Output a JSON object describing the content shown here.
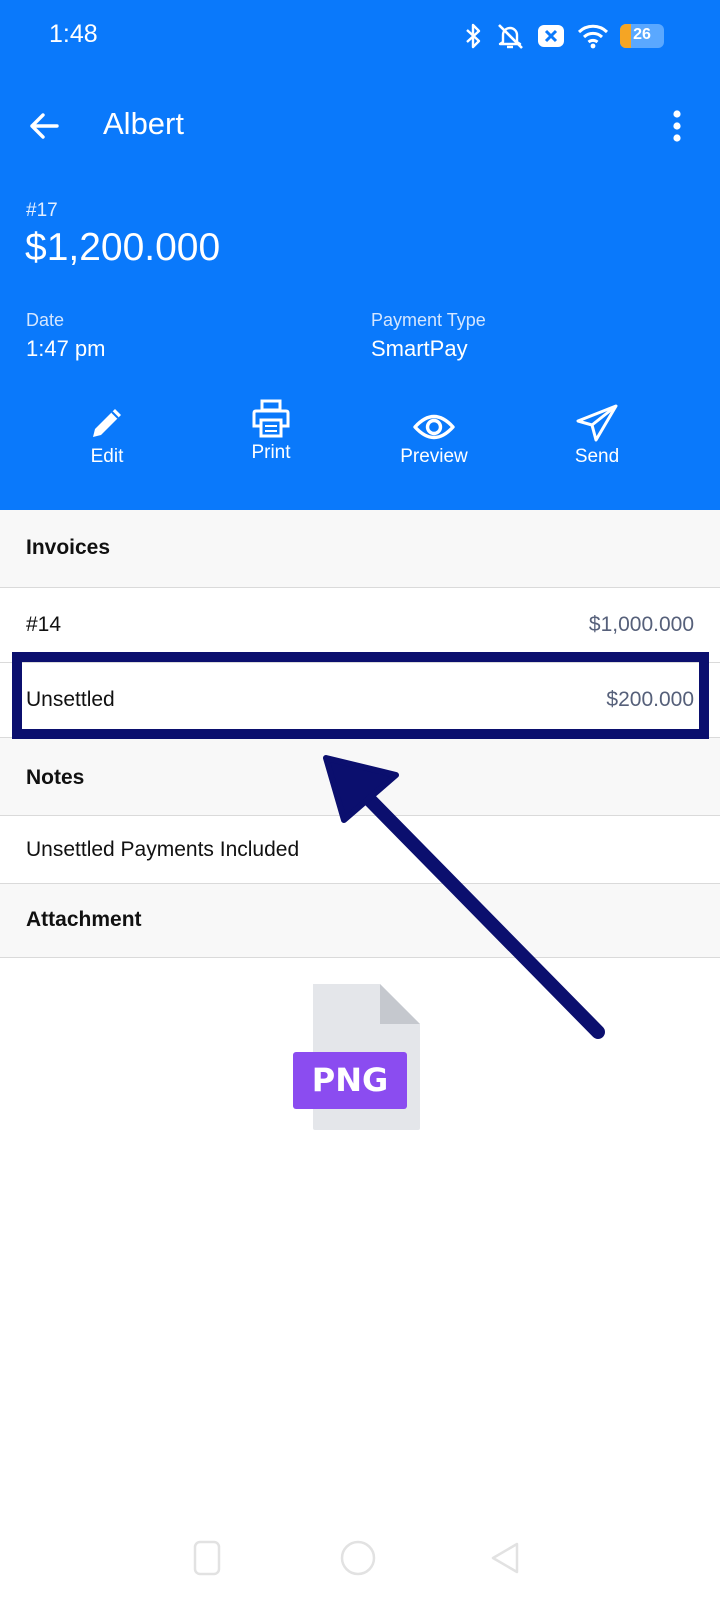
{
  "status_bar": {
    "time": "1:48",
    "battery": "26",
    "battery_level_percent": 26,
    "icons": [
      "bluetooth-icon",
      "mute-bell-icon",
      "x-badge-icon",
      "wifi-icon",
      "battery-icon"
    ]
  },
  "app_bar": {
    "title": "Albert",
    "back_icon": "arrow-left-icon",
    "menu_icon": "more-vert-icon"
  },
  "payment": {
    "number": "#17",
    "amount": "$1,200.000",
    "date_label": "Date",
    "date_value": "1:47 pm",
    "type_label": "Payment Type",
    "type_value": "SmartPay"
  },
  "actions": [
    {
      "label": "Edit",
      "icon": "pencil-icon"
    },
    {
      "label": "Print",
      "icon": "printer-icon"
    },
    {
      "label": "Preview",
      "icon": "eye-icon"
    },
    {
      "label": "Send",
      "icon": "paper-plane-icon"
    }
  ],
  "invoices": {
    "title": "Invoices",
    "rows": [
      {
        "label": "#14",
        "value": "$1,000.000"
      },
      {
        "label": "Unsettled",
        "value": "$200.000"
      }
    ]
  },
  "notes": {
    "title": "Notes",
    "text": "Unsettled Payments Included"
  },
  "attachment": {
    "title": "Attachment",
    "file_badge": "PNG",
    "icon": "png-file-icon"
  },
  "annotation_color": "#0b0f6e",
  "colors": {
    "header": "#0a79fb",
    "badge": "#8b4cf0"
  }
}
